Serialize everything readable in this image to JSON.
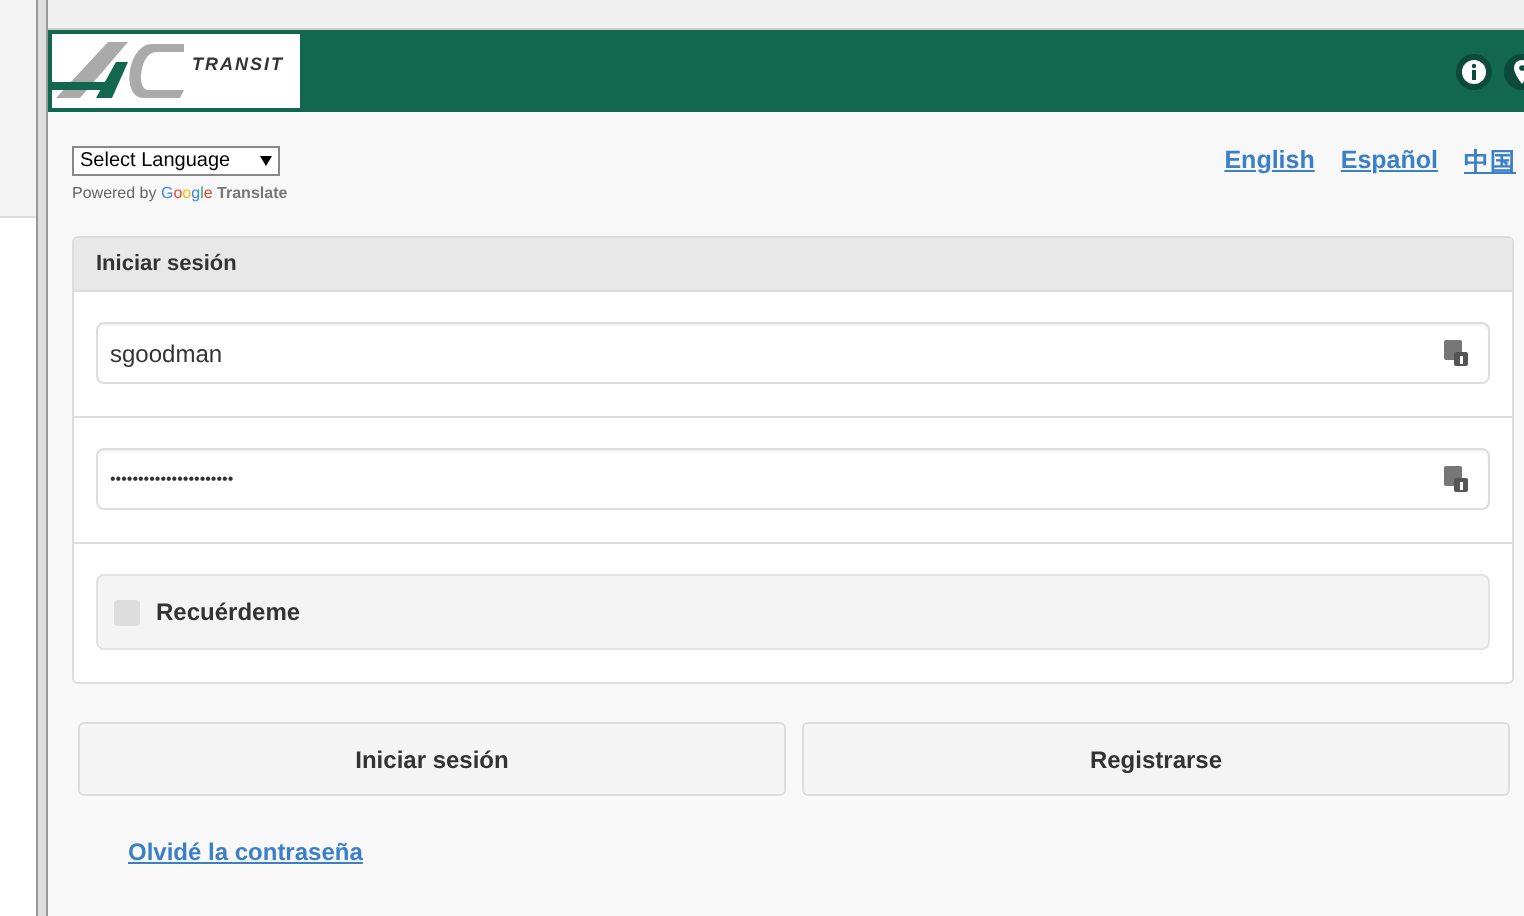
{
  "header": {
    "logo_text": "TRANSIT"
  },
  "translate": {
    "select": "Select Language",
    "powered_prefix": "Powered by",
    "powered_brand": "Google",
    "powered_suffix": "Translate"
  },
  "languages": [
    {
      "label": "English"
    },
    {
      "label": "Español"
    },
    {
      "label": "中国"
    }
  ],
  "login_panel": {
    "title": "Iniciar sesión",
    "username": "sgoodman",
    "password": "••••••••••••••••••••••",
    "remember": {
      "label": "Recuérdeme",
      "checked": false
    }
  },
  "buttons": [
    "Iniciar sesión",
    "Registrarse"
  ],
  "forgot_link": "Olvidé la contraseña"
}
